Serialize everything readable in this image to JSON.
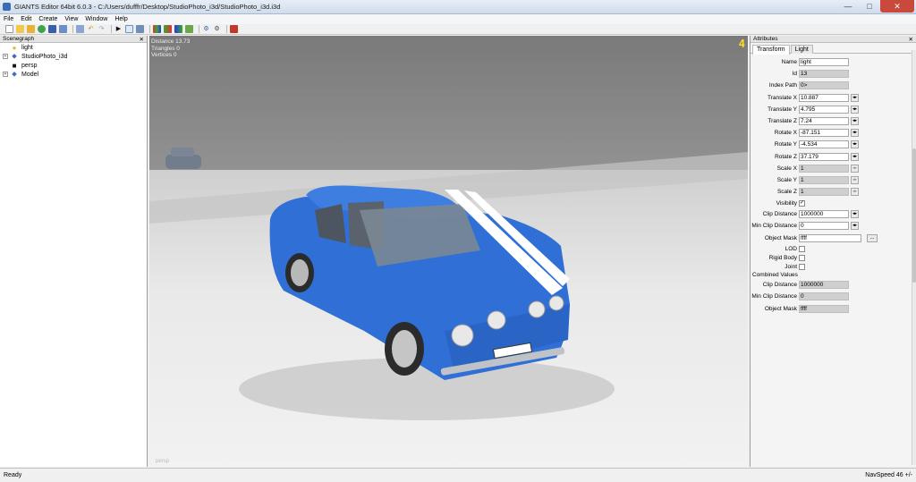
{
  "window": {
    "title": "GIANTS Editor 64bit 6.0.3 - C:/Users/dufffr/Desktop/StudioPhoto_i3d/StudioPhoto_i3d.i3d",
    "min": "—",
    "max": "□",
    "close": "✕"
  },
  "menu": [
    "File",
    "Edit",
    "Create",
    "View",
    "Window",
    "Help"
  ],
  "scenegraph": {
    "header": "Scenegraph",
    "close": "✕",
    "items": [
      {
        "label": "light",
        "icon": "bulb-icon",
        "expander": ""
      },
      {
        "label": "StudioPhoto_i3d",
        "icon": "transform-group-icon",
        "expander": "+"
      },
      {
        "label": "persp",
        "icon": "camera-icon",
        "expander": ""
      },
      {
        "label": "Model",
        "icon": "transform-group-icon",
        "expander": "+"
      }
    ]
  },
  "viewport": {
    "stats": [
      "Distance 13.73",
      "Triangles 0",
      "Vertices 0"
    ],
    "camera_index": "4",
    "camera_name": "persp",
    "close": "✕"
  },
  "attributes": {
    "header": "Attributes",
    "close": "✕",
    "tabs": [
      "Transform",
      "Light"
    ],
    "rows": {
      "name": {
        "label": "Name",
        "value": "light"
      },
      "id": {
        "label": "Id",
        "value": "13"
      },
      "index_path": {
        "label": "Index Path",
        "value": "0>"
      },
      "tx": {
        "label": "Translate X",
        "value": "10.887"
      },
      "ty": {
        "label": "Translate Y",
        "value": "4.795"
      },
      "tz": {
        "label": "Translate Z",
        "value": "7.24"
      },
      "rx": {
        "label": "Rotate X",
        "value": "-87.151"
      },
      "ry": {
        "label": "Rotate Y",
        "value": "-4.534"
      },
      "rz": {
        "label": "Rotate Z",
        "value": "37.179"
      },
      "sx": {
        "label": "Scale X",
        "value": "1"
      },
      "sy": {
        "label": "Scale Y",
        "value": "1"
      },
      "sz": {
        "label": "Scale Z",
        "value": "1"
      },
      "visibility": {
        "label": "Visibility",
        "checked": "✓"
      },
      "clip": {
        "label": "Clip Distance",
        "value": "1000000"
      },
      "min_clip": {
        "label": "Min Clip Distance",
        "value": "0"
      },
      "object_mask": {
        "label": "Object Mask",
        "value": "ffff"
      },
      "lod": {
        "label": "LOD"
      },
      "rigid": {
        "label": "Rigid Body"
      },
      "joint": {
        "label": "Joint"
      }
    },
    "combined_header": "Combined Values",
    "combined": {
      "clip": {
        "label": "Clip Distance",
        "value": "1000000"
      },
      "min_clip": {
        "label": "Min Clip Distance",
        "value": "0"
      },
      "object_mask": {
        "label": "Object Mask",
        "value": "ffff"
      }
    },
    "spin_glyph": "◂▸",
    "ellipsis": "..."
  },
  "status": {
    "left": "Ready",
    "right": "NavSpeed 46 +/-"
  },
  "colors": {
    "car_body": "#2f6fd6",
    "stripe": "#ffffff",
    "camera_index": "#ffdd22"
  }
}
